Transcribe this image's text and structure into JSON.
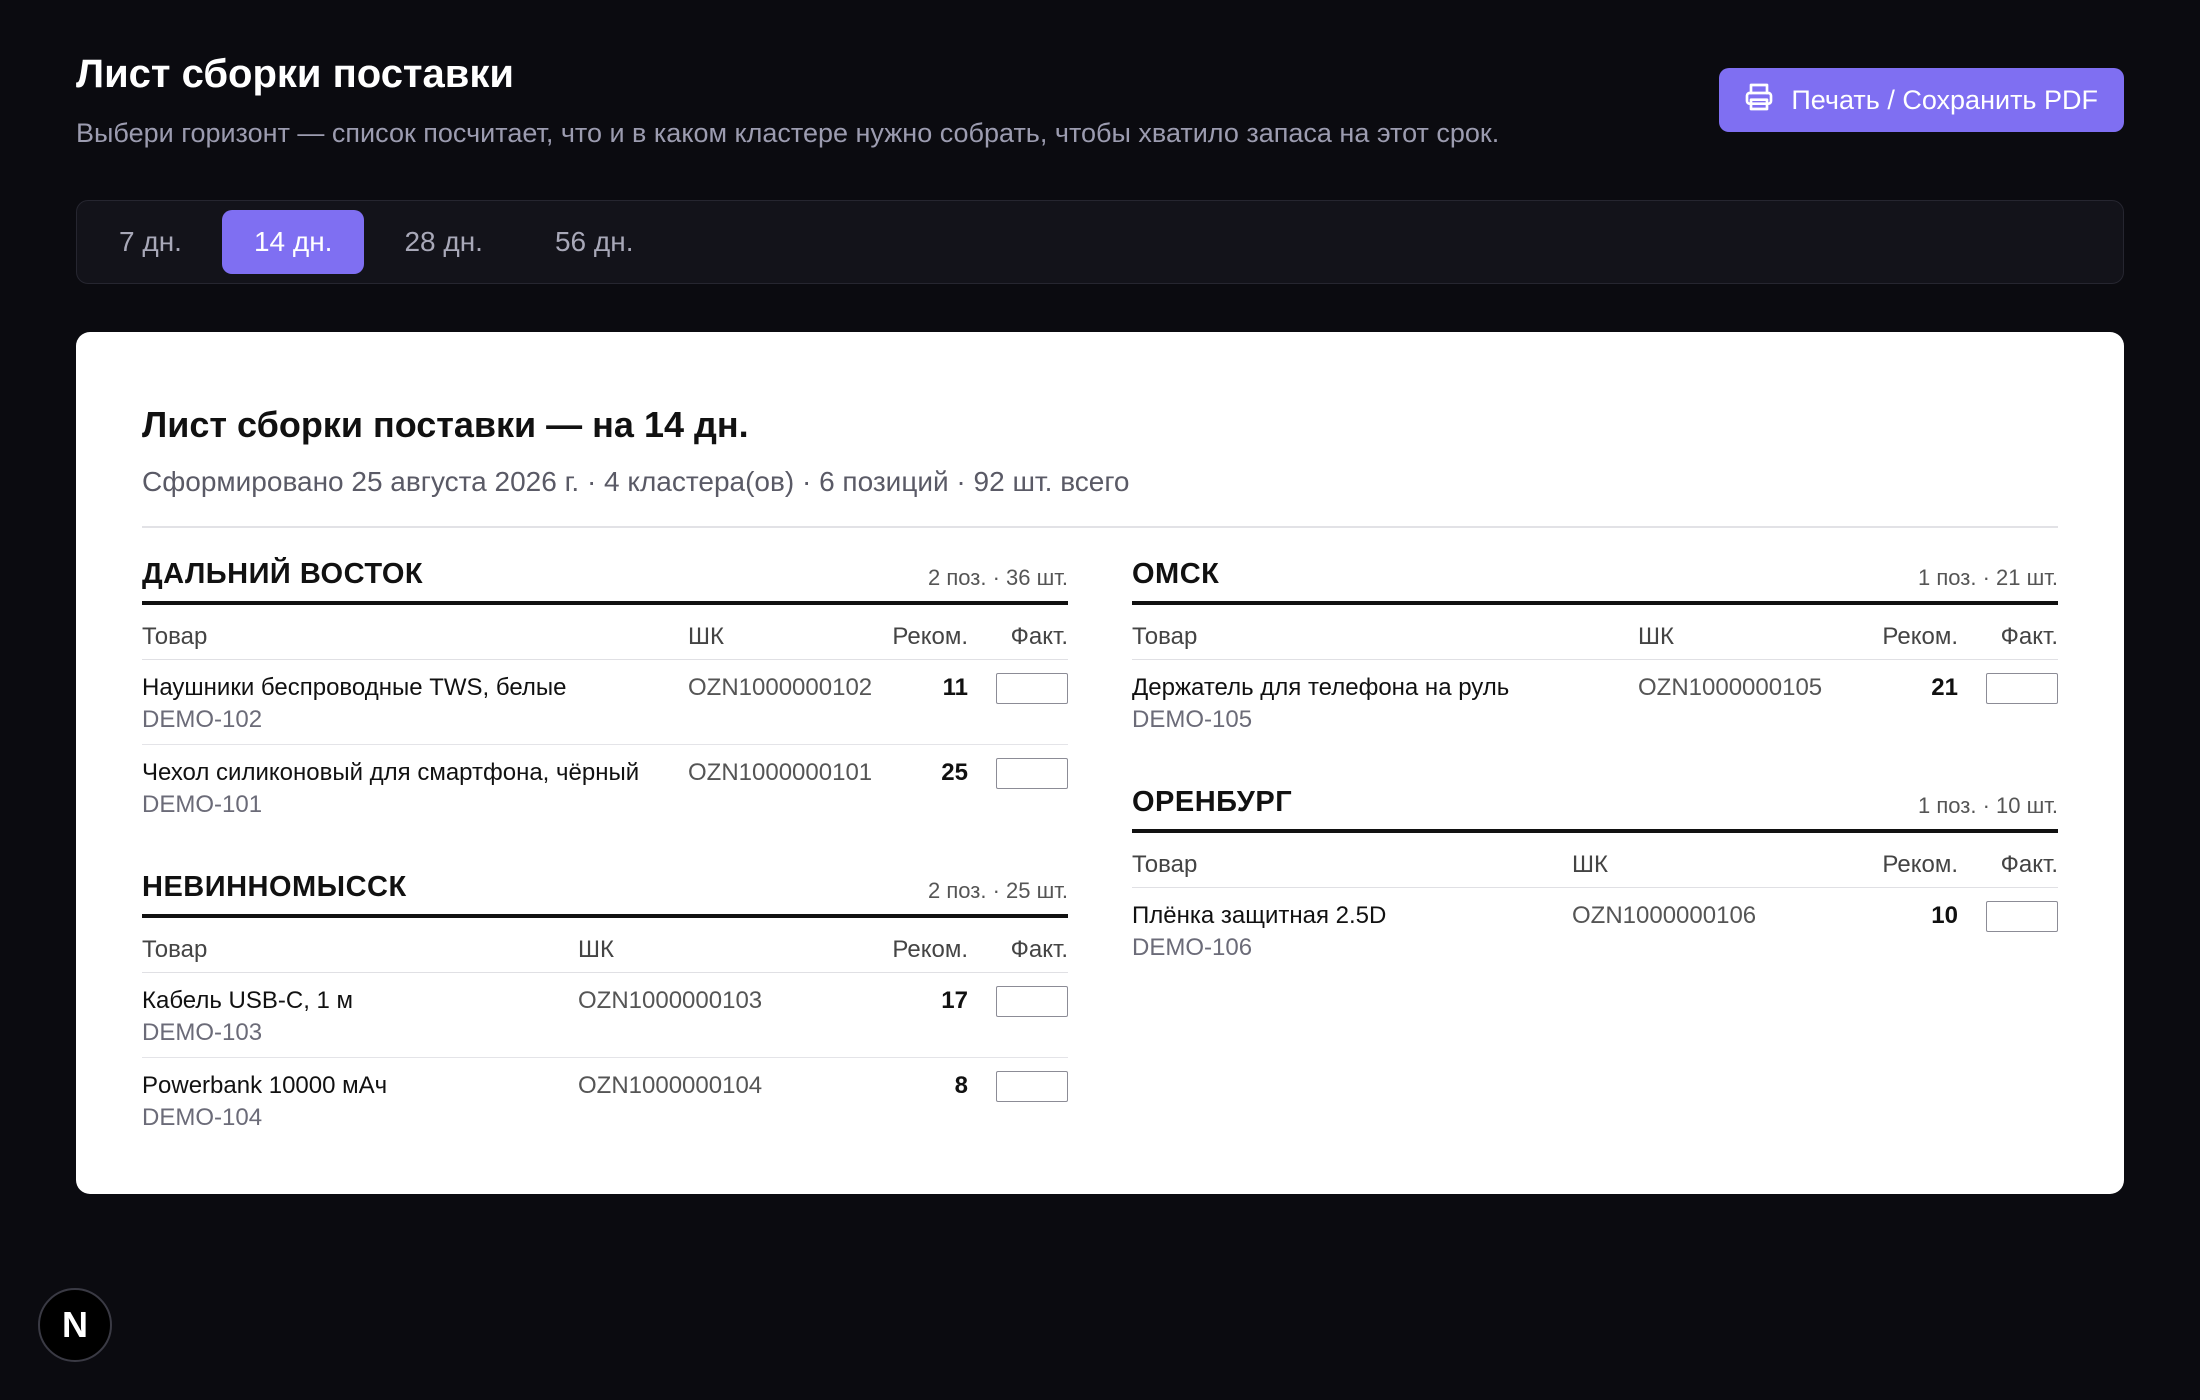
{
  "header": {
    "title": "Лист сборки поставки",
    "subtitle": "Выбери горизонт — список посчитает, что и в каком кластере нужно собрать, чтобы хватило запаса на этот срок.",
    "print_label": "Печать / Сохранить PDF"
  },
  "tabs": [
    {
      "label": "7 дн.",
      "active": false
    },
    {
      "label": "14 дн.",
      "active": true
    },
    {
      "label": "28 дн.",
      "active": false
    },
    {
      "label": "56 дн.",
      "active": false
    }
  ],
  "sheet": {
    "title": "Лист сборки поставки — на 14 дн.",
    "meta": "Сформировано 25 августа 2026 г. · 4 кластера(ов) · 6 позиций · 92 шт. всего",
    "columns": {
      "product": "Товар",
      "barcode": "ШК",
      "rec": "Реком.",
      "fact": "Факт."
    },
    "clusters": [
      {
        "name": "ДАЛЬНИЙ ВОСТОК",
        "summary": "2 поз. · 36 шт.",
        "items": [
          {
            "name": "Наушники беспроводные TWS, белые",
            "sku": "DEMO-102",
            "barcode": "OZN1000000102",
            "rec": "11"
          },
          {
            "name": "Чехол силиконовый для смартфона, чёрный",
            "sku": "DEMO-101",
            "barcode": "OZN1000000101",
            "rec": "25"
          }
        ]
      },
      {
        "name": "НЕВИННОМЫССК",
        "summary": "2 поз. · 25 шт.",
        "items": [
          {
            "name": "Кабель USB-C, 1 м",
            "sku": "DEMO-103",
            "barcode": "OZN1000000103",
            "rec": "17"
          },
          {
            "name": "Powerbank 10000 мАч",
            "sku": "DEMO-104",
            "barcode": "OZN1000000104",
            "rec": "8"
          }
        ]
      },
      {
        "name": "ОМСК",
        "summary": "1 поз. · 21 шт.",
        "items": [
          {
            "name": "Держатель для телефона на руль",
            "sku": "DEMO-105",
            "barcode": "OZN1000000105",
            "rec": "21"
          }
        ]
      },
      {
        "name": "ОРЕНБУРГ",
        "summary": "1 поз. · 10 шт.",
        "items": [
          {
            "name": "Плёнка защитная 2.5D",
            "sku": "DEMO-106",
            "barcode": "OZN1000000106",
            "rec": "10"
          }
        ]
      }
    ]
  },
  "badge": {
    "label": "N"
  }
}
